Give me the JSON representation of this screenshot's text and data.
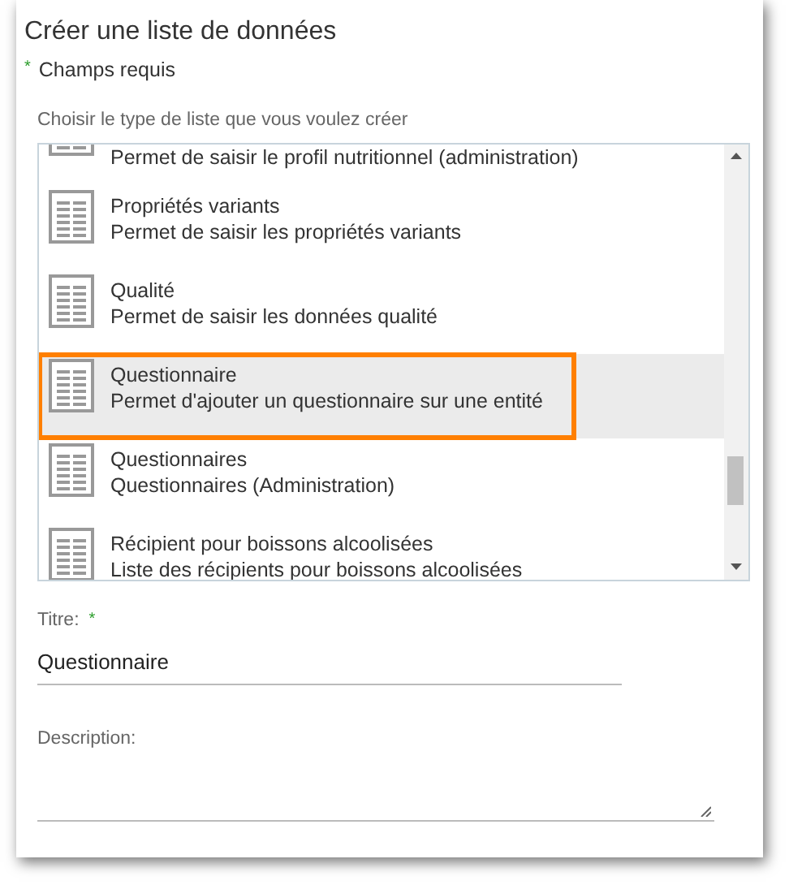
{
  "dialog": {
    "title": "Créer une liste de données",
    "required_note": {
      "mark": "*",
      "text": "Champs requis"
    }
  },
  "list_picker": {
    "label": "Choisir le type de liste que vous voulez créer",
    "items": [
      {
        "description": "Permet de saisir le profil nutritionnel (administration)",
        "selected": false,
        "highlighted": false
      },
      {
        "title": "Propriétés variants",
        "description": "Permet de saisir les propriétés variants",
        "selected": false,
        "highlighted": false
      },
      {
        "title": "Qualité",
        "description": "Permet de saisir les données qualité",
        "selected": false,
        "highlighted": false
      },
      {
        "title": "Questionnaire",
        "description": "Permet d'ajouter un questionnaire sur une entité",
        "selected": true,
        "highlighted": true
      },
      {
        "title": "Questionnaires",
        "description": "Questionnaires (Administration)",
        "selected": false,
        "highlighted": false
      },
      {
        "title": "Récipient pour boissons alcoolisées",
        "description": "Liste des récipients pour boissons alcoolisées",
        "selected": false,
        "highlighted": false
      }
    ]
  },
  "title_field": {
    "label": "Titre:",
    "required_mark": "*",
    "value": "Questionnaire"
  },
  "description_field": {
    "label": "Description:"
  }
}
